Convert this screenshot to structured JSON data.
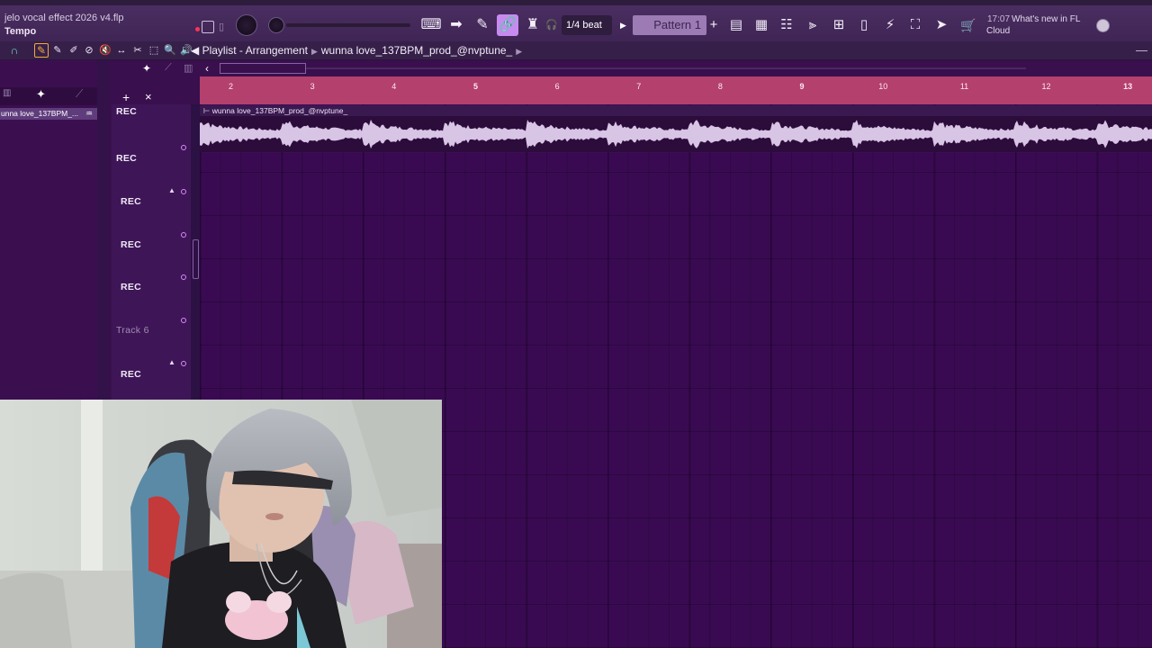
{
  "toolbar": {
    "project_title": "jelo vocal effect 2026 v4.flp",
    "tempo_label": "Tempo",
    "snap_value": "1/4 beat",
    "pattern_name": "Pattern 1",
    "pattern_add": "+",
    "news_time": "17:07",
    "news_text": "What's new in FL",
    "news_text2": "Cloud",
    "buttons": [
      {
        "name": "typing-keyboard-icon",
        "glyph": "⌨"
      },
      {
        "name": "arrow-right-icon",
        "glyph": "➡"
      },
      {
        "name": "pencil-icon",
        "glyph": "✎"
      },
      {
        "name": "link-icon",
        "glyph": "🔗"
      },
      {
        "name": "stamp-icon",
        "glyph": "♜"
      },
      {
        "name": "headphones-icon",
        "glyph": "🎧"
      }
    ],
    "right_buttons": [
      {
        "name": "playlist-icon",
        "glyph": "▤"
      },
      {
        "name": "piano-roll-icon",
        "glyph": "▦"
      },
      {
        "name": "channel-rack-icon",
        "glyph": "☷"
      },
      {
        "name": "mixer-icon",
        "glyph": "⫸"
      },
      {
        "name": "browser-icon",
        "glyph": "⊞"
      },
      {
        "name": "file-icon",
        "glyph": "▯"
      },
      {
        "name": "plugin-icon",
        "glyph": "⚡"
      },
      {
        "name": "tempo-tap-icon",
        "glyph": "⛶"
      },
      {
        "name": "send-icon",
        "glyph": "➤"
      }
    ]
  },
  "playlist": {
    "window_title": "Playlist - Arrangement",
    "pattern_name": "wunna love_137BPM_prod_@nvptune_",
    "tools": [
      {
        "name": "draw-tool-icon",
        "glyph": "✎"
      },
      {
        "name": "paint-tool-icon",
        "glyph": "✐"
      },
      {
        "name": "delete-tool-icon",
        "glyph": "⊘"
      },
      {
        "name": "mute-tool-icon",
        "glyph": "🔇"
      },
      {
        "name": "slip-tool-icon",
        "glyph": "↔"
      },
      {
        "name": "slice-tool-icon",
        "glyph": "✂"
      },
      {
        "name": "select-tool-icon",
        "glyph": "⬚"
      },
      {
        "name": "zoom-tool-icon",
        "glyph": "🔍"
      },
      {
        "name": "playback-tool-icon",
        "glyph": "🔊"
      }
    ]
  },
  "picker": {
    "clip_name": "unna love_137BPM_...",
    "add_label": "+",
    "close_label": "×"
  },
  "timeline": {
    "bars": [
      "2",
      "3",
      "4",
      "5",
      "6",
      "7",
      "8",
      "9",
      "10",
      "11",
      "12",
      "13"
    ],
    "major_bars": [
      "5",
      "9",
      "13"
    ]
  },
  "clip": {
    "title": "wunna love_137BPM_prod_@nvptune_"
  },
  "tracks": [
    {
      "label": "REC",
      "dim": false
    },
    {
      "label": "REC",
      "dim": false
    },
    {
      "label": "REC",
      "dim": false
    },
    {
      "label": "REC",
      "dim": false
    },
    {
      "label": "REC",
      "dim": false
    },
    {
      "label": "Track 6",
      "dim": true
    },
    {
      "label": "REC",
      "dim": false
    }
  ],
  "colors": {
    "timeline": "#b3406d",
    "grid": "#3e0c57",
    "accent": "#c78bf0",
    "waveform": "#d8c4e4"
  }
}
